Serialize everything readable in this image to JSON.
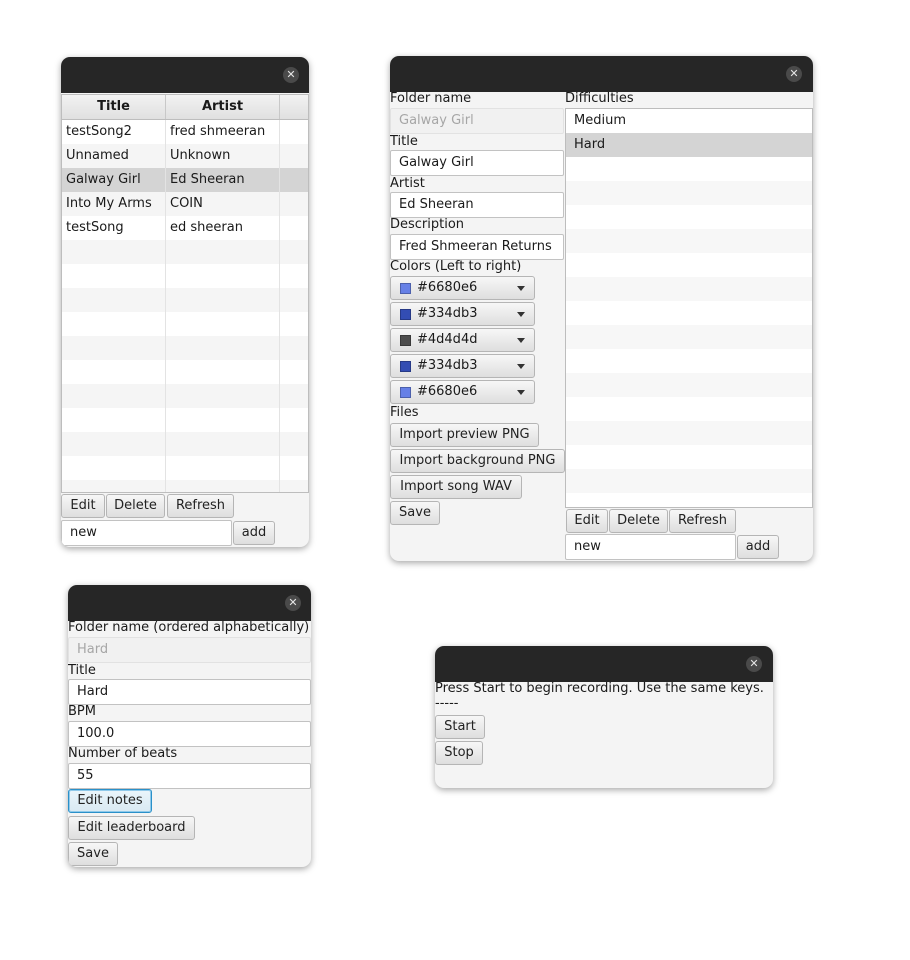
{
  "close_glyph": "✕",
  "songs_window": {
    "columns": [
      "Title",
      "Artist"
    ],
    "rows": [
      {
        "title": "testSong2",
        "artist": "fred shmeeran"
      },
      {
        "title": "Unnamed",
        "artist": "Unknown"
      },
      {
        "title": "Galway Girl",
        "artist": "Ed Sheeran"
      },
      {
        "title": "Into My Arms",
        "artist": "COIN"
      },
      {
        "title": "testSong",
        "artist": "ed sheeran"
      }
    ],
    "selected_index": 2,
    "edit_label": "Edit",
    "delete_label": "Delete",
    "refresh_label": "Refresh",
    "new_value": "new",
    "add_label": "add"
  },
  "song_editor": {
    "folder_label": "Folder name",
    "folder_value": "Galway Girl",
    "title_label": "Title",
    "title_value": "Galway Girl",
    "artist_label": "Artist",
    "artist_value": "Ed Sheeran",
    "description_label": "Description",
    "description_value": "Fred Shmeeran Returns",
    "colors_label": "Colors (Left to right)",
    "colors": [
      {
        "value": "#6680e6",
        "color": "#6680e6"
      },
      {
        "value": "#334db3",
        "color": "#334db3"
      },
      {
        "value": "#4d4d4d",
        "color": "#4d4d4d"
      },
      {
        "value": "#334db3",
        "color": "#334db3"
      },
      {
        "value": "#6680e6",
        "color": "#6680e6"
      }
    ],
    "files_label": "Files",
    "import_preview_label": "Import preview PNG",
    "import_background_label": "Import background PNG",
    "import_song_label": "Import song WAV",
    "save_label": "Save",
    "difficulties_label": "Difficulties",
    "difficulties": [
      "Medium",
      "Hard"
    ],
    "selected_difficulty": 1,
    "edit_label": "Edit",
    "delete_label": "Delete",
    "refresh_label": "Refresh",
    "new_value": "new",
    "add_label": "add"
  },
  "difficulty_editor": {
    "folder_label": "Folder name (ordered alphabetically)",
    "folder_value": "Hard",
    "title_label": "Title",
    "title_value": "Hard",
    "bpm_label": "BPM",
    "bpm_value": "100.0",
    "beats_label": "Number of beats",
    "beats_value": "55",
    "edit_notes_label": "Edit notes",
    "edit_leaderboard_label": "Edit leaderboard",
    "save_label": "Save"
  },
  "recorder": {
    "instructions": "Press Start to begin recording. Use the same keys.",
    "separator": "-----",
    "start_label": "Start",
    "stop_label": "Stop"
  }
}
